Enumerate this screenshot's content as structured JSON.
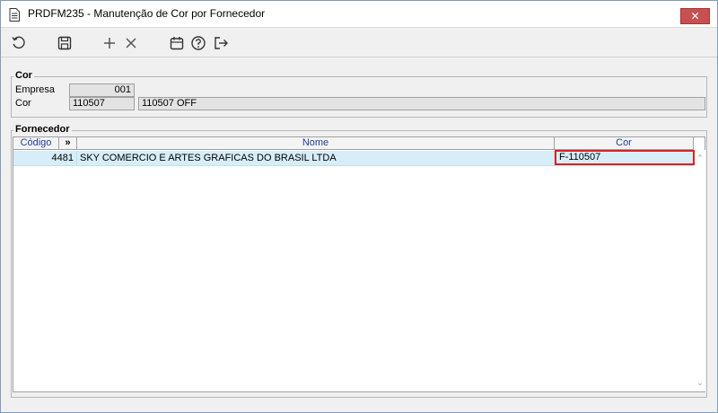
{
  "window": {
    "title": "PRDFM235 - Manutenção de Cor por Fornecedor",
    "close_label": "✕"
  },
  "toolbar": {
    "icons": [
      "refresh-icon",
      "save-icon",
      "add-icon",
      "delete-icon",
      "calendar-icon",
      "help-icon",
      "exit-icon"
    ]
  },
  "cor_group": {
    "title": "Cor",
    "empresa_label": "Empresa",
    "empresa_value": "001",
    "cor_label": "Cor",
    "cor_code": "110507",
    "cor_desc": "110507 OFF"
  },
  "fornecedor_group": {
    "title": "Fornecedor",
    "columns": {
      "codigo": "Código",
      "expand": "»",
      "nome": "Nome",
      "cor": "Cor"
    },
    "rows": [
      {
        "codigo": "4481",
        "nome": "SKY COMERCIO E ARTES GRAFICAS DO BRASIL LTDA",
        "cor": "F-110507"
      }
    ]
  },
  "colors": {
    "selection": "#d7eef9",
    "header_text": "#1f3d99",
    "highlight_border": "#e02020",
    "close_button": "#c75050"
  }
}
